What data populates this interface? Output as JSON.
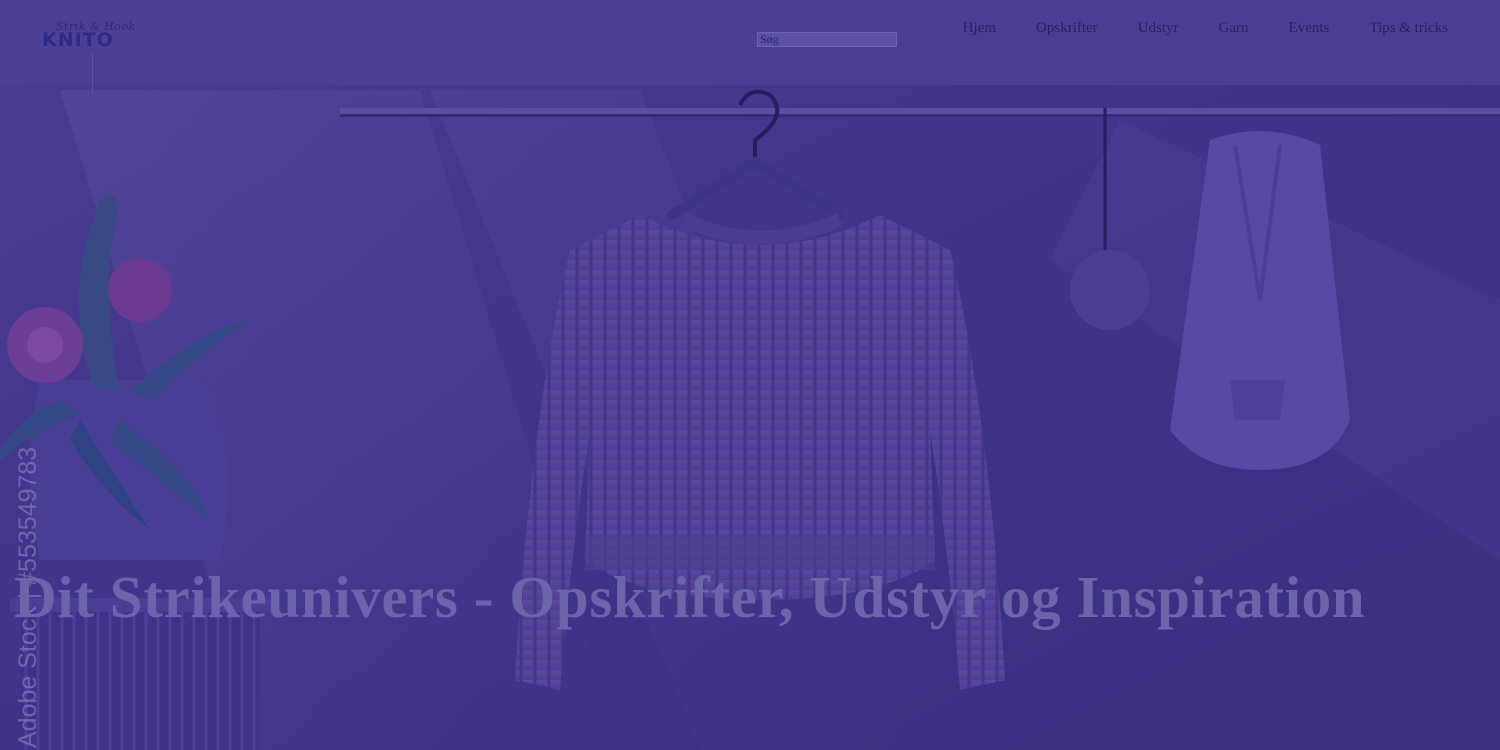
{
  "header": {
    "logo": {
      "script_text": "Strik & Hook",
      "name": "KNITO"
    },
    "search": {
      "placeholder": "Søg"
    },
    "nav": [
      {
        "label": "Hjem"
      },
      {
        "label": "Opskrifter"
      },
      {
        "label": "Udstyr"
      },
      {
        "label": "Garn"
      },
      {
        "label": "Events"
      },
      {
        "label": "Tips & tricks"
      }
    ]
  },
  "hero": {
    "title": "Dit Strikeunivers - Opskrifter, Udstyr og Inspiration",
    "image_watermark": "Adobe Stock | #553549783"
  },
  "colors": {
    "overlay": "#3f3383",
    "header_bg": "#4e4096",
    "title": "#6c64ab",
    "nav_text": "#241f63"
  }
}
